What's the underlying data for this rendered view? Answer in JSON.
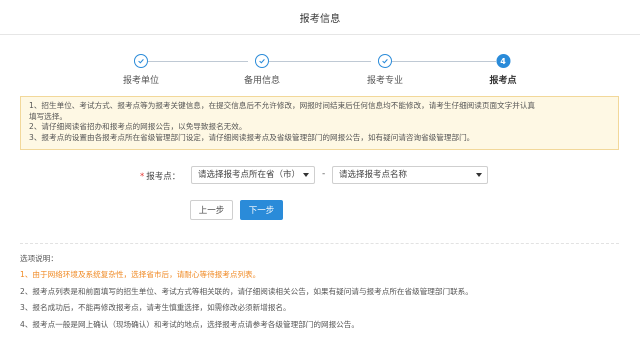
{
  "header": {
    "title": "报考信息"
  },
  "steps": [
    {
      "label": "报考单位",
      "state": "done",
      "icon": "check-icon"
    },
    {
      "label": "备用信息",
      "state": "done",
      "icon": "check-icon"
    },
    {
      "label": "报考专业",
      "state": "done",
      "icon": "check-icon"
    },
    {
      "label": "报考点",
      "state": "active",
      "number": "4"
    }
  ],
  "notice": {
    "lines": [
      "1、招生单位、考试方式、报考点等为报考关键信息，在提交信息后不允许修改，网报时间结束后任何信息均不能修改，请考生仔细阅读页面文字并认真",
      "填写选择。",
      "2、请仔细阅读省招办和报考点的网报公告，以免导致报名无效。",
      "3、报考点的设置由各报考点所在省级管理部门设定，请仔细阅读报考点及省级管理部门的网报公告，如有疑问请咨询省级管理部门。"
    ]
  },
  "form": {
    "required_mark": "*",
    "label": "报考点：",
    "province_select": "请选择报考点所在省（市）",
    "separator": "-",
    "site_select": "请选择报考点名称"
  },
  "buttons": {
    "prev": "上一步",
    "next": "下一步"
  },
  "instructions": {
    "title": "选项说明：",
    "items": [
      "1、由于网络环境及系统复杂性，选择省市后，请耐心等待报考点列表。",
      "2、报考点列表是和前面填写的招生单位、考试方式等相关联的，请仔细阅读相关公告，如果有疑问请与报考点所在省级管理部门联系。",
      "3、报名成功后，不能再修改报考点，请考生慎重选择，如需修改必须新增报名。",
      "4、报考点一般是网上确认（现场确认）和考试的地点，选择报考点请参考各级管理部门的网报公告。"
    ]
  },
  "colors": {
    "primary": "#2a8bd9",
    "notice_bg": "#fef8e4",
    "notice_border": "#f2d89a",
    "highlight": "#f08a24",
    "required": "#e53935"
  }
}
